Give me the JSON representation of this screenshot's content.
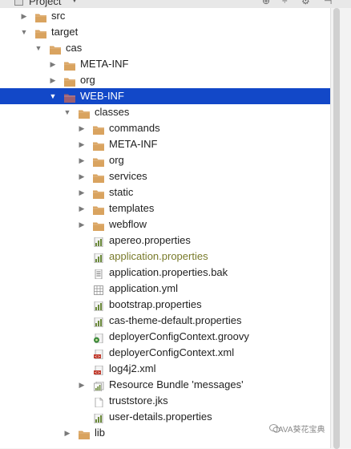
{
  "header": {
    "title": "Project"
  },
  "tree": [
    {
      "label": "src",
      "icon": "folder-icon",
      "arrow": "collapsed"
    },
    {
      "label": "target",
      "icon": "folder-icon",
      "arrow": "expanded"
    },
    {
      "label": "cas",
      "icon": "folder-icon",
      "arrow": "expanded"
    },
    {
      "label": "META-INF",
      "icon": "folder-icon",
      "arrow": "collapsed"
    },
    {
      "label": "org",
      "icon": "folder-icon",
      "arrow": "collapsed"
    },
    {
      "label": "WEB-INF",
      "icon": "folder-icon",
      "arrow": "expanded",
      "selected": true
    },
    {
      "label": "classes",
      "icon": "folder-icon",
      "arrow": "expanded"
    },
    {
      "label": "commands",
      "icon": "folder-icon",
      "arrow": "collapsed"
    },
    {
      "label": "META-INF",
      "icon": "folder-icon",
      "arrow": "collapsed"
    },
    {
      "label": "org",
      "icon": "folder-icon",
      "arrow": "collapsed"
    },
    {
      "label": "services",
      "icon": "folder-icon",
      "arrow": "collapsed"
    },
    {
      "label": "static",
      "icon": "folder-icon",
      "arrow": "collapsed"
    },
    {
      "label": "templates",
      "icon": "folder-icon",
      "arrow": "collapsed"
    },
    {
      "label": "webflow",
      "icon": "folder-icon",
      "arrow": "collapsed"
    },
    {
      "label": "apereo.properties",
      "icon": "properties-file-icon",
      "arrow": "none"
    },
    {
      "label": "application.properties",
      "icon": "properties-file-icon",
      "arrow": "none",
      "modified": true
    },
    {
      "label": "application.properties.bak",
      "icon": "text-file-icon",
      "arrow": "none"
    },
    {
      "label": "application.yml",
      "icon": "yml-file-icon",
      "arrow": "none"
    },
    {
      "label": "bootstrap.properties",
      "icon": "properties-file-icon",
      "arrow": "none"
    },
    {
      "label": "cas-theme-default.properties",
      "icon": "properties-file-icon",
      "arrow": "none"
    },
    {
      "label": "deployerConfigContext.groovy",
      "icon": "groovy-file-icon",
      "arrow": "none"
    },
    {
      "label": "deployerConfigContext.xml",
      "icon": "xml-file-icon",
      "arrow": "none"
    },
    {
      "label": "log4j2.xml",
      "icon": "xml-file-icon",
      "arrow": "none"
    },
    {
      "label": "Resource Bundle 'messages'",
      "icon": "resource-bundle-icon",
      "arrow": "collapsed"
    },
    {
      "label": "truststore.jks",
      "icon": "generic-file-icon",
      "arrow": "none"
    },
    {
      "label": "user-details.properties",
      "icon": "properties-file-icon",
      "arrow": "none"
    },
    {
      "label": "lib",
      "icon": "folder-icon",
      "arrow": "collapsed"
    }
  ],
  "colors": {
    "selection": "#1248c8",
    "folder": "#d9a35f",
    "folder_selected": "#9b5e72",
    "modified_text": "#787a2a"
  },
  "watermark": "JAVA葵花宝典"
}
